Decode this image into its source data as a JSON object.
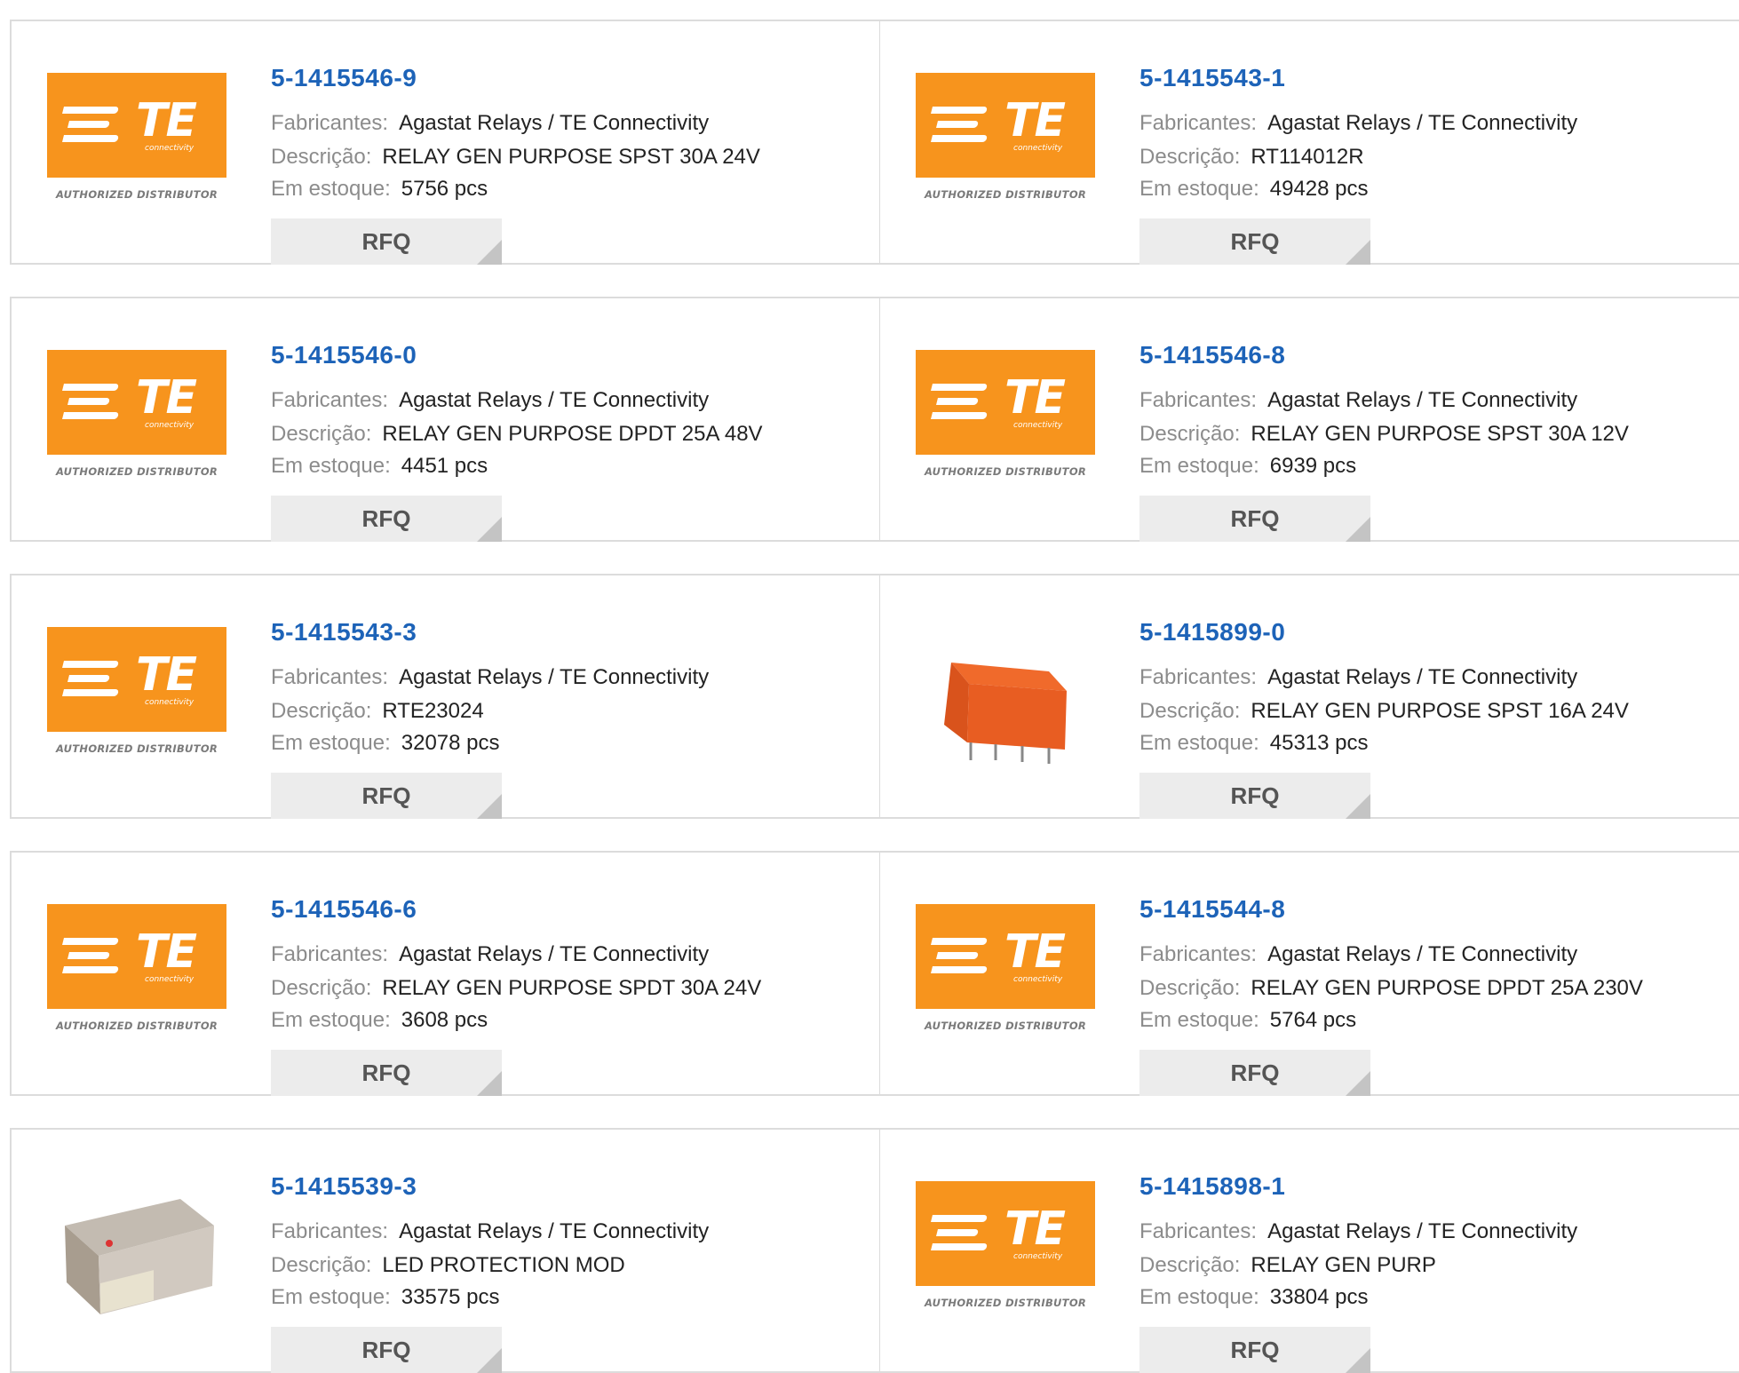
{
  "labels": {
    "manufacturer": "Fabricantes:",
    "description": "Descrição:",
    "stock": "Em estoque:",
    "rfq": "RFQ"
  },
  "logo": {
    "brand": "TE",
    "tagline": "connectivity",
    "footer": "AUTHORIZED DISTRIBUTOR",
    "color": "#f7941d"
  },
  "products": [
    {
      "part": "5-1415546-9",
      "manufacturer": "Agastat Relays / TE Connectivity",
      "description": "RELAY GEN PURPOSE SPST 30A 24V",
      "stock": "5756 pcs",
      "image": "te-logo"
    },
    {
      "part": "5-1415543-1",
      "manufacturer": "Agastat Relays / TE Connectivity",
      "description": "RT114012R",
      "stock": "49428 pcs",
      "image": "te-logo"
    },
    {
      "part": "5-1415546-0",
      "manufacturer": "Agastat Relays / TE Connectivity",
      "description": "RELAY GEN PURPOSE DPDT 25A 48V",
      "stock": "4451 pcs",
      "image": "te-logo"
    },
    {
      "part": "5-1415546-8",
      "manufacturer": "Agastat Relays / TE Connectivity",
      "description": "RELAY GEN PURPOSE SPST 30A 12V",
      "stock": "6939 pcs",
      "image": "te-logo"
    },
    {
      "part": "5-1415543-3",
      "manufacturer": "Agastat Relays / TE Connectivity",
      "description": "RTE23024",
      "stock": "32078 pcs",
      "image": "te-logo"
    },
    {
      "part": "5-1415899-0",
      "manufacturer": "Agastat Relays / TE Connectivity",
      "description": "RELAY GEN PURPOSE SPST 16A 24V",
      "stock": "45313 pcs",
      "image": "relay-photo"
    },
    {
      "part": "5-1415546-6",
      "manufacturer": "Agastat Relays / TE Connectivity",
      "description": "RELAY GEN PURPOSE SPDT 30A 24V",
      "stock": "3608 pcs",
      "image": "te-logo"
    },
    {
      "part": "5-1415544-8",
      "manufacturer": "Agastat Relays / TE Connectivity",
      "description": "RELAY GEN PURPOSE DPDT 25A 230V",
      "stock": "5764 pcs",
      "image": "te-logo"
    },
    {
      "part": "5-1415539-3",
      "manufacturer": "Agastat Relays / TE Connectivity",
      "description": "LED PROTECTION MOD",
      "stock": "33575 pcs",
      "image": "module-photo"
    },
    {
      "part": "5-1415898-1",
      "manufacturer": "Agastat Relays / TE Connectivity",
      "description": "RELAY GEN PURP",
      "stock": "33804 pcs",
      "image": "te-logo"
    }
  ]
}
